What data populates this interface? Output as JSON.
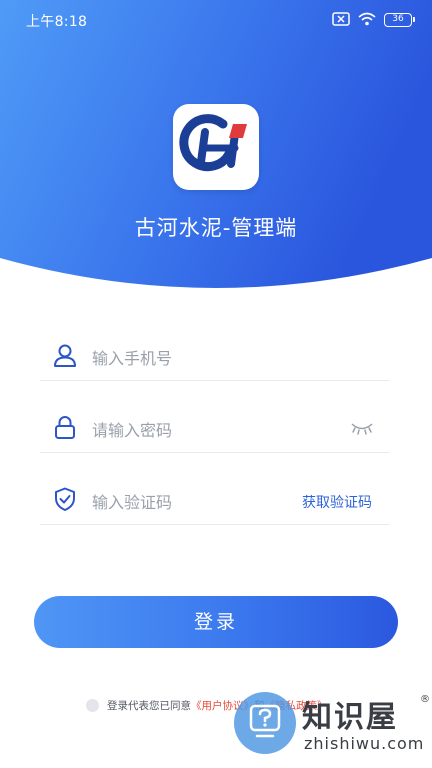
{
  "status_bar": {
    "time": "上午8:18",
    "battery": "36"
  },
  "header": {
    "app_title": "古河水泥-管理端",
    "logo_icon": "gh-logo-icon"
  },
  "form": {
    "phone_placeholder": "输入手机号",
    "password_placeholder": "请输入密码",
    "code_placeholder": "输入验证码",
    "get_code_label": "获取验证码"
  },
  "login_button": {
    "label": "登录"
  },
  "agreement": {
    "prefix": "登录代表您已同意",
    "user_agreement": "《用户协议》",
    "conj": "和",
    "privacy_policy": "《隐私政策》"
  },
  "watermark": {
    "cn": "知识屋",
    "en": "zhishiwu.com",
    "reg": "®"
  },
  "colors": {
    "primary": "#3b78ee",
    "link": "#e84a3a",
    "gradient_start": "#4f96f5",
    "gradient_end": "#2a58df"
  }
}
